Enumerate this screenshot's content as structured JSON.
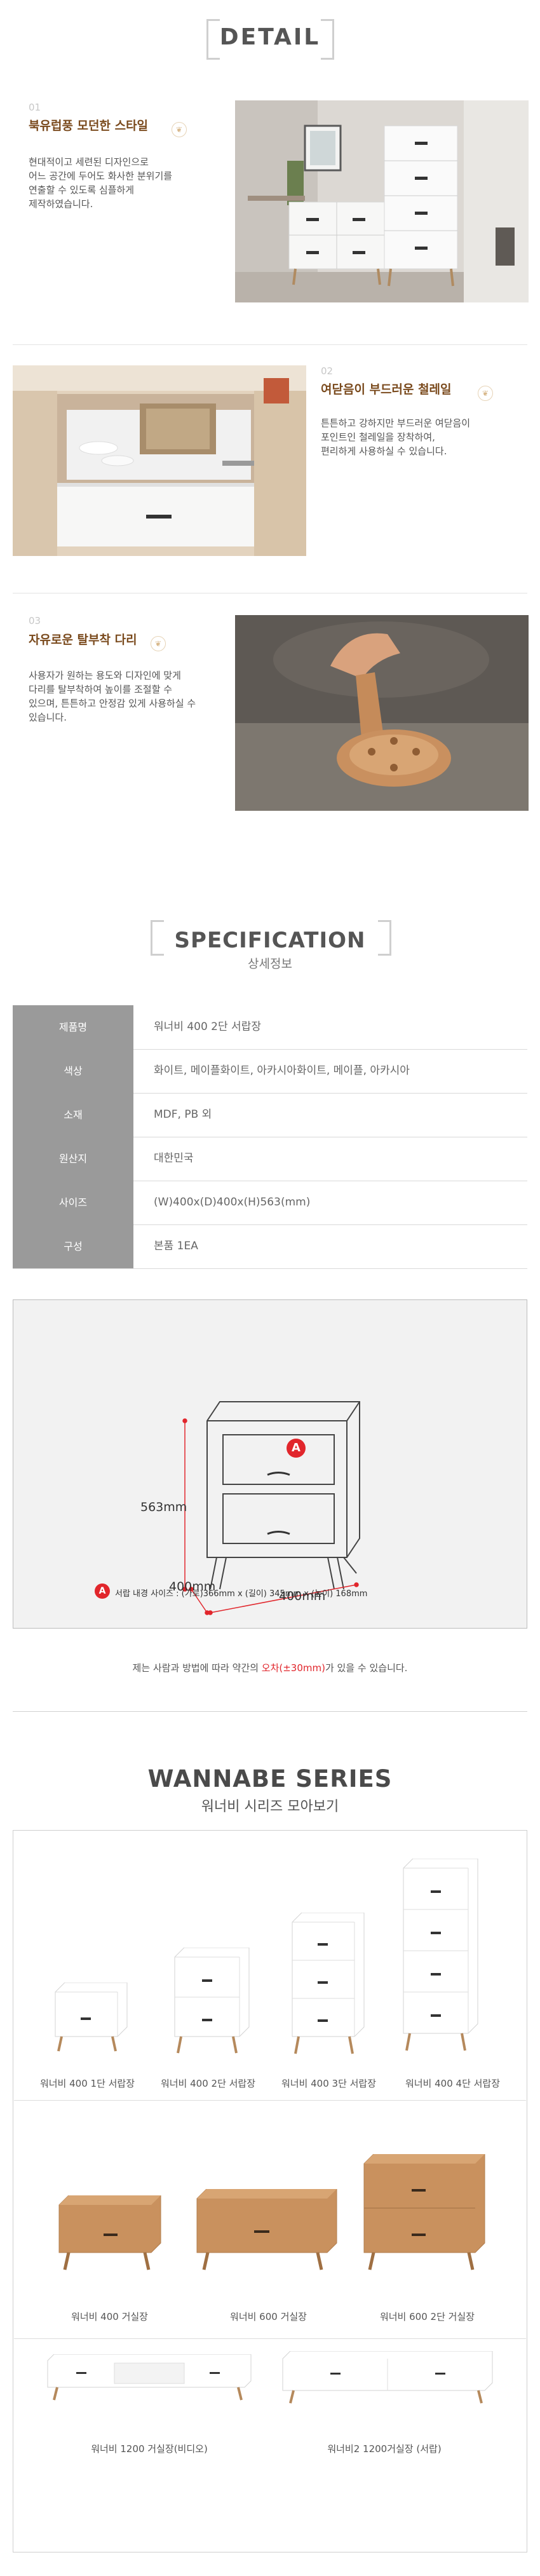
{
  "detail": {
    "title": "DETAIL",
    "features": [
      {
        "num": "01",
        "title": "북유럽풍 모던한 스타일",
        "desc": "현대적이고 세련된 디자인으로\n어느 공간에 두어도 화사한 분위기를\n연출할 수 있도록 심플하게\n제작하였습니다."
      },
      {
        "num": "02",
        "title": "여닫음이 부드러운 철레일",
        "desc": "튼튼하고 강하지만 부드러운 여닫음이\n포인트인 철레일을 장착하여,\n편리하게 사용하실 수 있습니다."
      },
      {
        "num": "03",
        "title": "자유로운 탈부착 다리",
        "desc": "사용자가 원하는 용도와 디자인에 맞게\n다리를 탈부착하여 높이를 조절할 수\n있으며, 튼튼하고 안정감 있게 사용하실 수\n있습니다."
      }
    ]
  },
  "spec": {
    "title": "SPECIFICATION",
    "subtitle": "상세정보",
    "rows": [
      {
        "label": "제품명",
        "value": "워너비 400 2단 서랍장"
      },
      {
        "label": "색상",
        "value": "화이트, 메이플화이트, 아카시아화이트, 메이플, 아카시아"
      },
      {
        "label": "소재",
        "value": "MDF, PB 외"
      },
      {
        "label": "원산지",
        "value": "대한민국"
      },
      {
        "label": "사이즈",
        "value": "(W)400x(D)400x(H)563(mm)"
      },
      {
        "label": "구성",
        "value": "본품 1EA"
      }
    ],
    "diagram": {
      "height_label": "563mm",
      "depth_label": "400mm",
      "width_label": "400mm",
      "marker": "A",
      "inner_size_label": "서랍 내경 사이즈 : (가로)366mm x (길이) 345mm x (높이) 168mm"
    },
    "note_before": "제는 사람과 방법에 따라 약간의 ",
    "note_red": "오차(±30mm)",
    "note_after": "가 있을 수 있습니다."
  },
  "series": {
    "title": "WANNABE SERIES",
    "subtitle": "워너비 시리즈 모아보기",
    "items": [
      {
        "name": "워너비 400 1단 서랍장"
      },
      {
        "name": "워너비 400 2단 서랍장"
      },
      {
        "name": "워너비 400 3단 서랍장"
      },
      {
        "name": "워너비 400 4단 서랍장"
      },
      {
        "name": "워너비 400 거실장"
      },
      {
        "name": "워너비 600 거실장"
      },
      {
        "name": "워너비 600 2단 거실장"
      },
      {
        "name": "워너비 1200 거실장(비디오)"
      },
      {
        "name": "워너비2 1200거실장 (서랍)"
      }
    ]
  },
  "colors": {
    "accent": "#7a4a1d",
    "highlight": "#f5dfc0",
    "label_bg": "#9a9a9a",
    "red": "#e1262c"
  },
  "icons": [
    "leaf-icon",
    "circle-a-marker-icon"
  ]
}
